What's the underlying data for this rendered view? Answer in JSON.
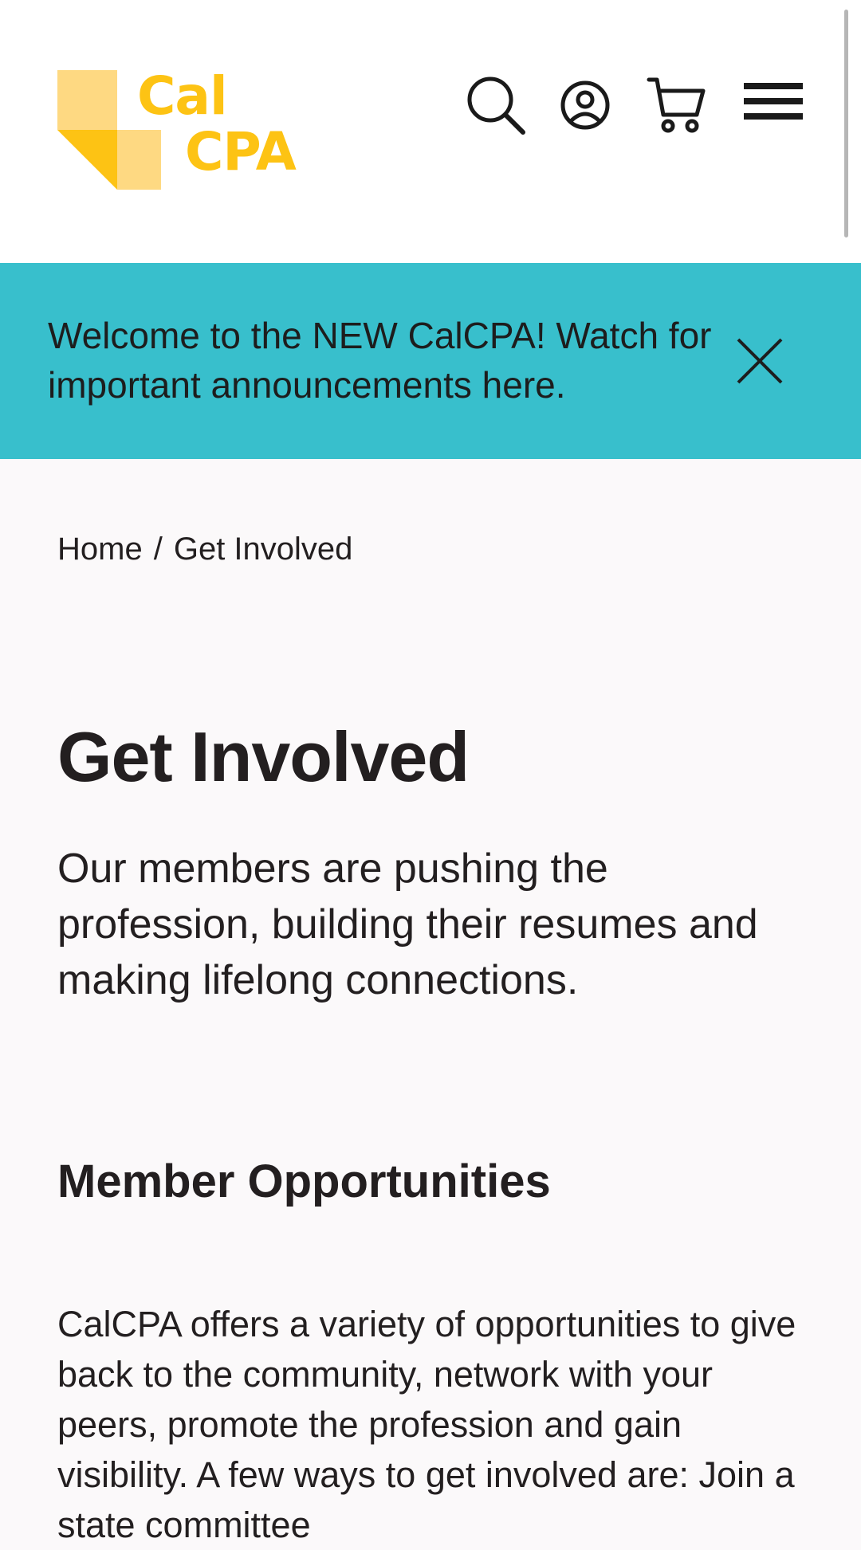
{
  "header": {
    "logo": {
      "line1": "Cal",
      "line2": "CPA",
      "color": "#fdc314"
    },
    "icons": [
      {
        "name": "search-icon"
      },
      {
        "name": "account-icon"
      },
      {
        "name": "cart-icon"
      },
      {
        "name": "menu-icon"
      }
    ]
  },
  "announcement": {
    "text": "Welcome to the NEW CalCPA! Watch for important announcements here.",
    "background": "#38bfcc"
  },
  "breadcrumb": {
    "home": "Home",
    "separator": "/",
    "current": "Get Involved"
  },
  "main": {
    "title": "Get Involved",
    "lead": "Our members are pushing the profession, building their resumes and making lifelong connections.",
    "section_title": "Member Opportunities",
    "body": "CalCPA offers a variety of opportunities to give back to the community, network with your peers, promote the profession and gain visibility. A few ways to get involved are: Join a state committee"
  }
}
